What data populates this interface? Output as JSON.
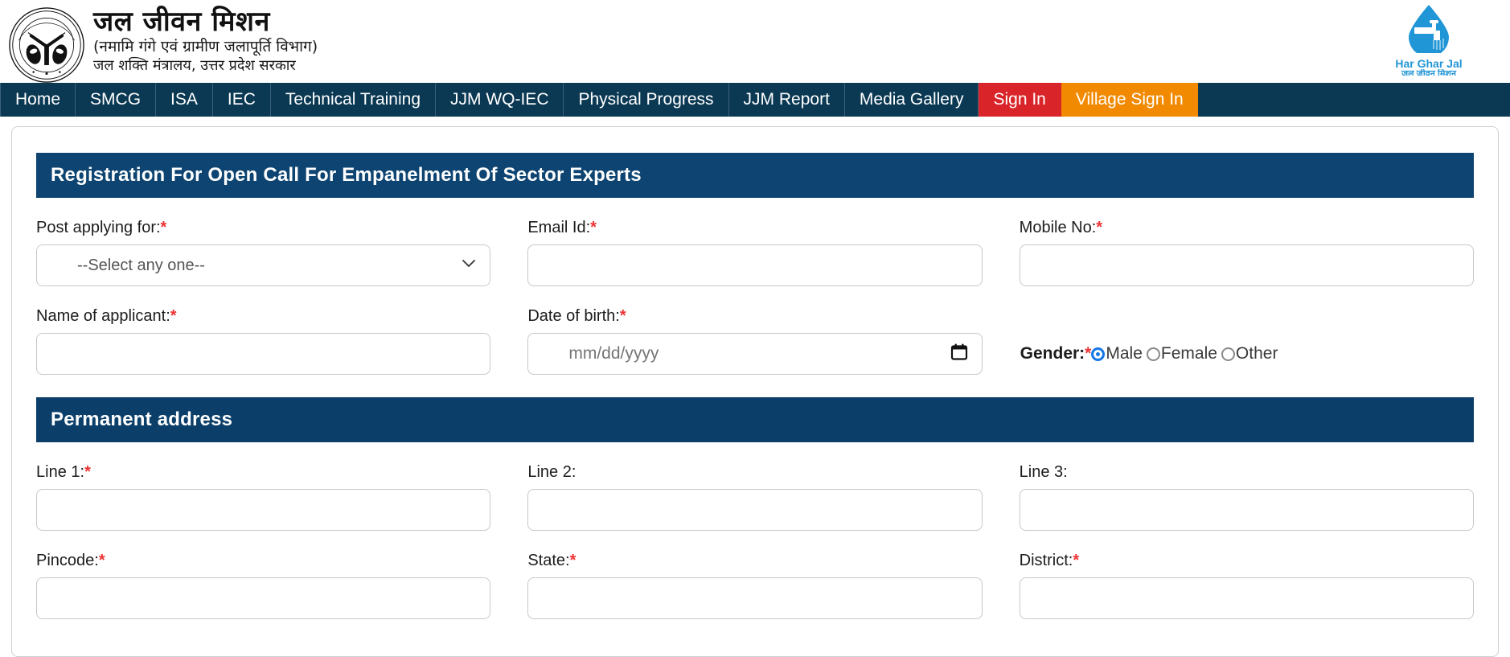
{
  "header": {
    "emblem_icon": "uttar-pradesh-government-emblem",
    "title_hi": "जल जीवन मिशन",
    "subtitle_hi_1": "(नमामि गंगे एवं ग्रामीण जलापूर्ति विभाग)",
    "subtitle_hi_2": "जल शक्ति मंत्रालय, उत्तर प्रदेश सरकार",
    "logo_icon": "har-ghar-jal-water-drop-tap-icon",
    "logo_text_1": "Har Ghar Jal",
    "logo_text_2": "जल जीवन मिशन",
    "logo_color": "#2196d6"
  },
  "nav": {
    "bg_color": "#0b3954",
    "signin_color": "#d9252a",
    "village_color": "#f18a00",
    "items": [
      {
        "label": "Home",
        "style": "default"
      },
      {
        "label": "SMCG",
        "style": "default"
      },
      {
        "label": "ISA",
        "style": "default"
      },
      {
        "label": "IEC",
        "style": "default"
      },
      {
        "label": "Technical Training",
        "style": "default"
      },
      {
        "label": "JJM WQ-IEC",
        "style": "default"
      },
      {
        "label": "Physical Progress",
        "style": "default"
      },
      {
        "label": "JJM Report",
        "style": "default"
      },
      {
        "label": "Media Gallery",
        "style": "default"
      },
      {
        "label": "Sign In",
        "style": "signin"
      },
      {
        "label": "Village Sign In",
        "style": "village"
      }
    ]
  },
  "form": {
    "section_title": "Registration For Open Call For Empanelment Of Sector Experts",
    "section_bg": "#0d4471",
    "required_mark": "*",
    "post_applying": {
      "label": "Post applying for:",
      "required": true,
      "selected_option": "--Select any one--",
      "options": [
        "--Select any one--"
      ],
      "chevron_icon": "chevron-down-icon"
    },
    "email": {
      "label": "Email Id:",
      "required": true,
      "value": "",
      "placeholder": ""
    },
    "mobile": {
      "label": "Mobile No:",
      "required": true,
      "value": "",
      "placeholder": ""
    },
    "applicant_name": {
      "label": "Name of applicant:",
      "required": true,
      "value": "",
      "placeholder": ""
    },
    "dob": {
      "label": "Date of birth:",
      "required": true,
      "value": "",
      "placeholder": "mm/dd/yyyy",
      "calendar_icon": "calendar-icon"
    },
    "gender": {
      "label": "Gender:",
      "required": true,
      "selected": "Male",
      "options": [
        {
          "label": "Male",
          "selected": true
        },
        {
          "label": "Female",
          "selected": false
        },
        {
          "label": "Other",
          "selected": false
        }
      ],
      "accent_color": "#1878e8"
    },
    "permanent_address": {
      "section_title": "Permanent address",
      "section_bg": "#0b3f6a",
      "line1": {
        "label": "Line 1:",
        "required": true,
        "value": ""
      },
      "line2": {
        "label": "Line 2:",
        "required": false,
        "value": ""
      },
      "line3": {
        "label": "Line 3:",
        "required": false,
        "value": ""
      },
      "pincode": {
        "label": "Pincode:",
        "required": true,
        "value": ""
      },
      "state": {
        "label": "State:",
        "required": true,
        "value": ""
      },
      "district": {
        "label": "District:",
        "required": true,
        "value": ""
      }
    }
  }
}
